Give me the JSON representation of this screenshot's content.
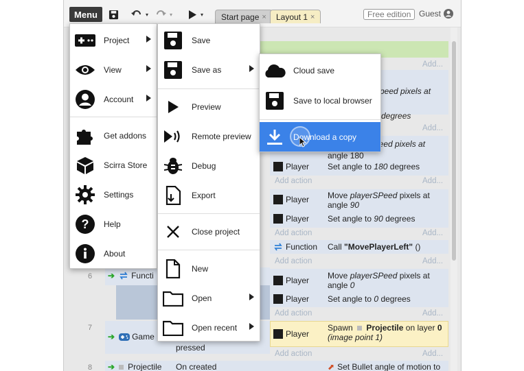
{
  "toolbar": {
    "menu_label": "Menu",
    "tabs": [
      {
        "label": "Start page",
        "close": "×"
      },
      {
        "label": "Layout 1",
        "close": "×"
      }
    ],
    "free_edition": "Free edition",
    "user": "Guest"
  },
  "sheet": {
    "rows": [
      {
        "object": "Player",
        "action": "Move playerSPeed pixels at angle 90"
      },
      {
        "object": "Player",
        "action": "Set angle to 180 degrees"
      },
      {
        "object": "Player",
        "action": "Set angle to 90 degrees"
      },
      {
        "object": "Function",
        "action": "Call \"MovePlayerLeft\" ()"
      },
      {
        "object": "Player",
        "action": "Move playerSPeed pixels at angle 0"
      },
      {
        "object": "Player",
        "action": "Set angle to 0 degrees"
      },
      {
        "object": "Player",
        "action": "Spawn Projectile on layer 0 (image point 1)"
      }
    ],
    "add_action": "Add action",
    "add_short": "Add...",
    "line_numbers": [
      "6",
      "7",
      "8"
    ],
    "event_labels": {
      "function": "Functi",
      "gamepad": "Game",
      "pressed": "pressed",
      "projectile": "Projectile",
      "on_created": "On created",
      "bullet": "Set Bullet angle of motion to"
    },
    "partial_texts": {
      "speed_pixels_at_1": "Speed pixels at",
      "degrees_0": "0 degrees",
      "speed_pixels_at_2": "peed pixels at",
      "angle_180": "angle 180"
    },
    "action_parts": {
      "move": "Move",
      "speed_var": "playerSPeed",
      "pixels_at": "pixels at",
      "angle_word": "angle",
      "angle_90": "90",
      "angle_0": "0",
      "set_angle_to": "Set angle to",
      "deg_180": "180",
      "deg_90": "90",
      "deg_0": "0",
      "degrees": "degrees",
      "call": "Call",
      "func_name": "\"MovePlayerLeft\"",
      "func_args": "()",
      "spawn": "Spawn",
      "projectile": "Projectile",
      "on_layer": "on layer",
      "layer": "0",
      "image_point": "(image point 1)"
    }
  },
  "main_menu": {
    "items": [
      {
        "label": "Project",
        "icon": "gamepad-icon",
        "submenu": true
      },
      {
        "label": "View",
        "icon": "eye-icon",
        "submenu": true
      },
      {
        "label": "Account",
        "icon": "account-icon",
        "submenu": true
      },
      {
        "label": "Get addons",
        "icon": "puzzle-icon",
        "submenu": false
      },
      {
        "label": "Scirra Store",
        "icon": "store-icon",
        "submenu": false
      },
      {
        "label": "Settings",
        "icon": "gear-icon",
        "submenu": false
      },
      {
        "label": "Help",
        "icon": "help-icon",
        "submenu": false
      },
      {
        "label": "About",
        "icon": "info-icon",
        "submenu": false
      }
    ]
  },
  "project_menu": {
    "items": [
      {
        "label": "Save",
        "icon": "floppy-icon",
        "submenu": false
      },
      {
        "label": "Save as",
        "icon": "floppy-icon",
        "submenu": true
      },
      {
        "label": "Preview",
        "icon": "play-icon",
        "submenu": false
      },
      {
        "label": "Remote preview",
        "icon": "remote-preview-icon",
        "submenu": false
      },
      {
        "label": "Debug",
        "icon": "bug-icon",
        "submenu": false
      },
      {
        "label": "Export",
        "icon": "export-icon",
        "submenu": false
      },
      {
        "label": "Close project",
        "icon": "close-icon",
        "submenu": false
      },
      {
        "label": "New",
        "icon": "file-icon",
        "submenu": false
      },
      {
        "label": "Open",
        "icon": "folder-icon",
        "submenu": true
      },
      {
        "label": "Open recent",
        "icon": "folder-icon",
        "submenu": true
      }
    ]
  },
  "saveas_menu": {
    "items": [
      {
        "label": "Cloud save",
        "icon": "cloud-icon"
      },
      {
        "label": "Save to local browser",
        "icon": "floppy-icon"
      },
      {
        "label": "Download a copy",
        "icon": "download-icon",
        "highlighted": true
      }
    ]
  },
  "colors": {
    "highlight": "#3b82e8",
    "menu_button": "#3a3a3a",
    "spawn_row": "#fbf1c5",
    "sheet_row": "#dde4ef"
  }
}
